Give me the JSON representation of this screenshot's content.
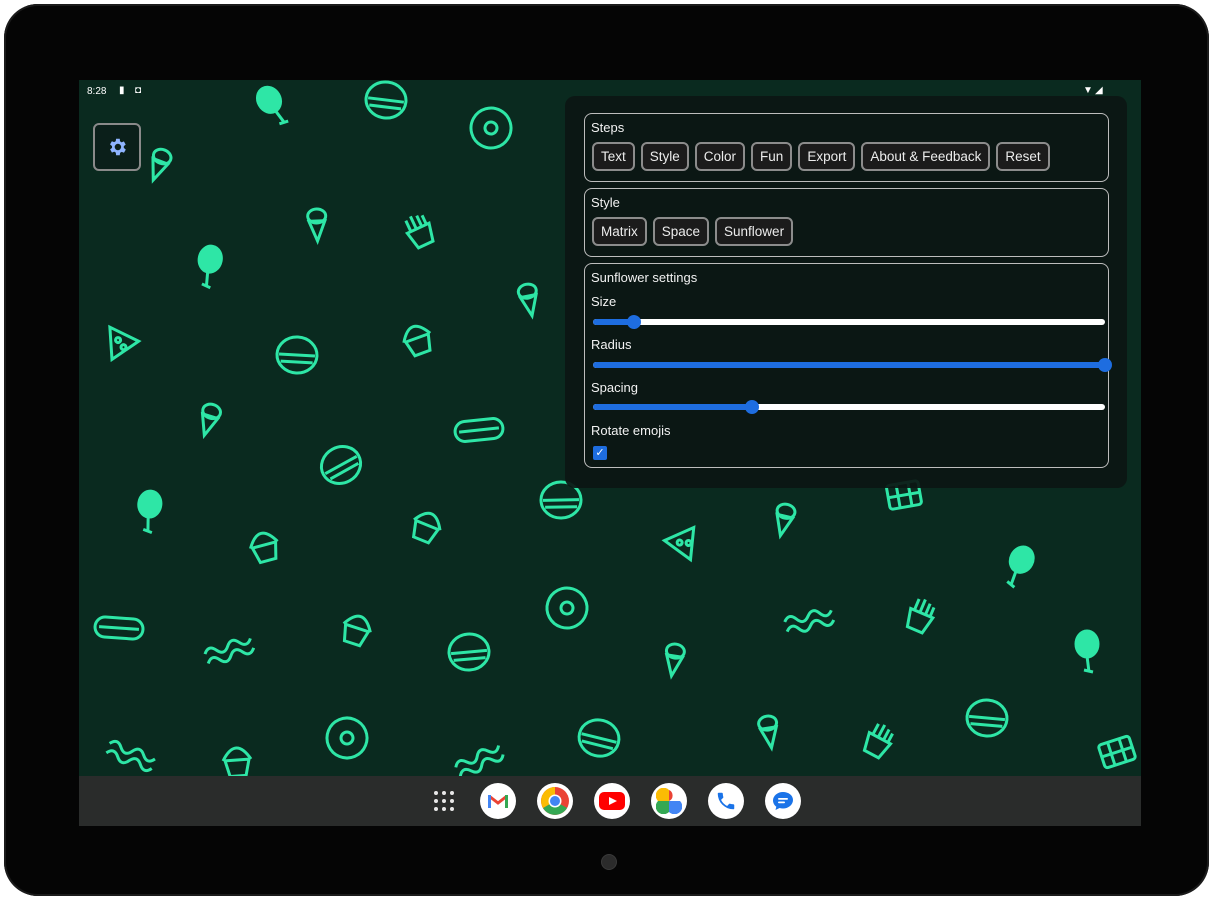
{
  "status_bar": {
    "time": "8:28"
  },
  "settings_icon": "gear-icon",
  "steps": {
    "title": "Steps",
    "buttons": [
      "Text",
      "Style",
      "Color",
      "Fun",
      "Export",
      "About & Feedback",
      "Reset"
    ]
  },
  "style": {
    "title": "Style",
    "buttons": [
      "Matrix",
      "Space",
      "Sunflower"
    ]
  },
  "sunflower_settings": {
    "title": "Sunflower settings",
    "size": {
      "label": "Size",
      "value": 0.08
    },
    "radius": {
      "label": "Radius",
      "value": 1.0
    },
    "spacing": {
      "label": "Spacing",
      "value": 0.31
    },
    "rotate_emojis": {
      "label": "Rotate emojis",
      "checked": true
    }
  },
  "dock": {
    "apps": [
      "app-drawer-icon",
      "gmail-icon",
      "chrome-icon",
      "youtube-icon",
      "photos-icon",
      "phone-icon",
      "messages-icon"
    ]
  },
  "colors": {
    "background": "#0a2a1f",
    "emoji": "#2ee6a6",
    "accent": "#1e6de0",
    "panel": "#0c1613"
  }
}
